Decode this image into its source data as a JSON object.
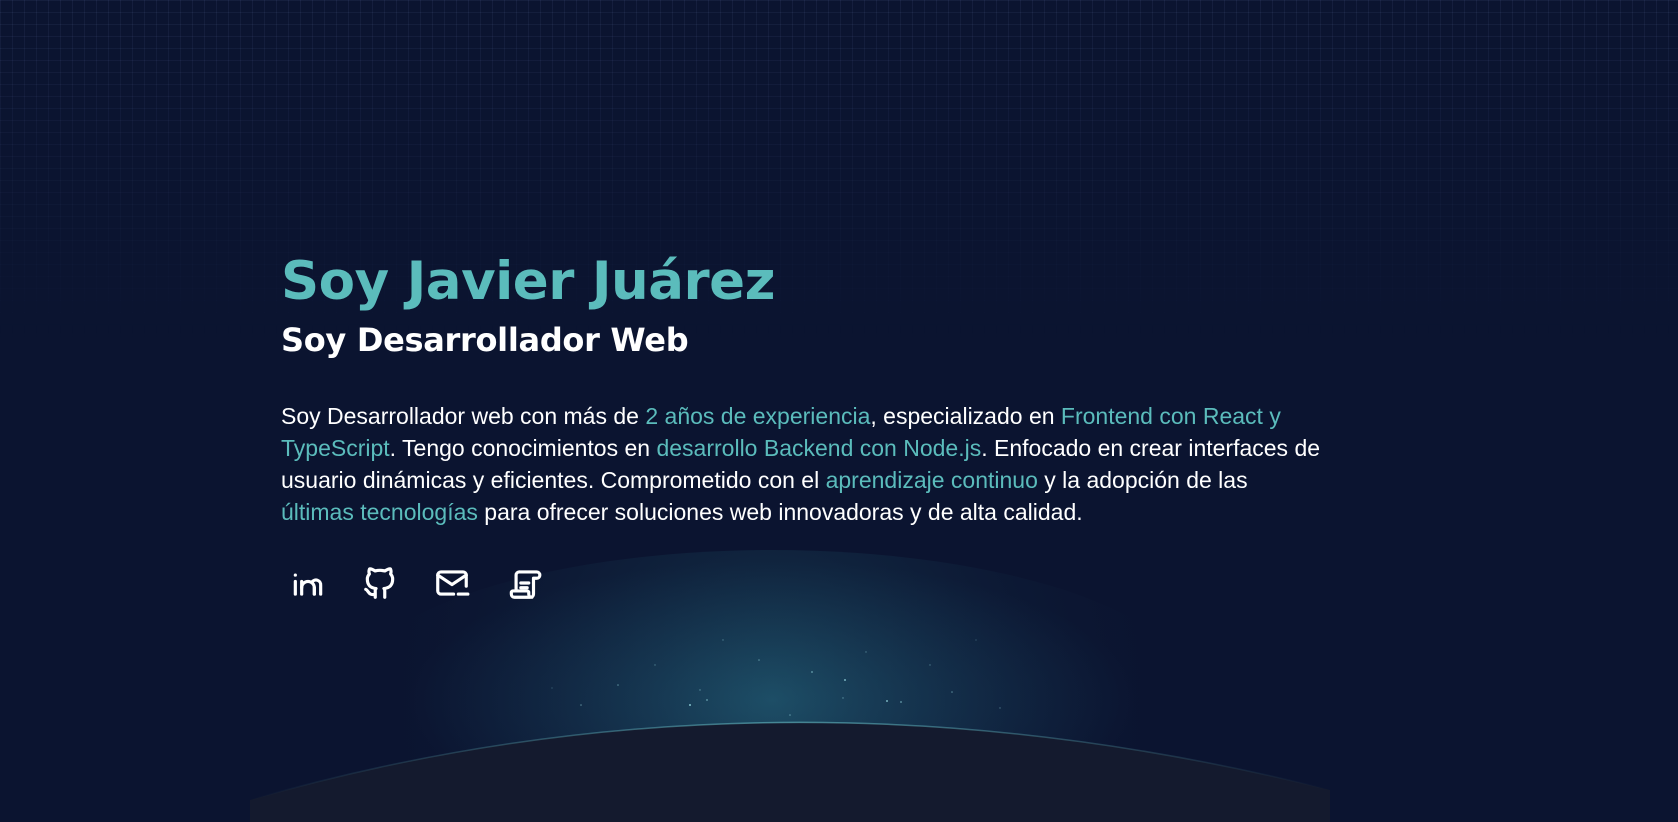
{
  "hero": {
    "name": "Soy Javier Juárez",
    "role": "Soy Desarrollador Web",
    "bio": {
      "t1": "Soy Desarrollador web con más de ",
      "h1": "2 años de experiencia",
      "t2": ", especializado en ",
      "h2": "Frontend con React y TypeScript",
      "t3": ". Tengo conocimientos en ",
      "h3": "desarrollo Backend con Node.js",
      "t4": ". Enfocado en crear interfaces de usuario dinámicas y eficientes. Comprometido con el ",
      "h4": "aprendizaje continuo",
      "t5": " y la adopción de las ",
      "h5": "últimas tecnologías",
      "t6": " para ofrecer soluciones web innovadoras y de alta calidad."
    }
  },
  "social": [
    {
      "icon": "linkedin-icon"
    },
    {
      "icon": "github-icon"
    },
    {
      "icon": "mail-icon"
    },
    {
      "icon": "resume-scroll-icon"
    }
  ],
  "colors": {
    "background": "#0b1430",
    "accent": "#5bbcbc",
    "text": "#ffffff",
    "planet": "#141a2e"
  }
}
